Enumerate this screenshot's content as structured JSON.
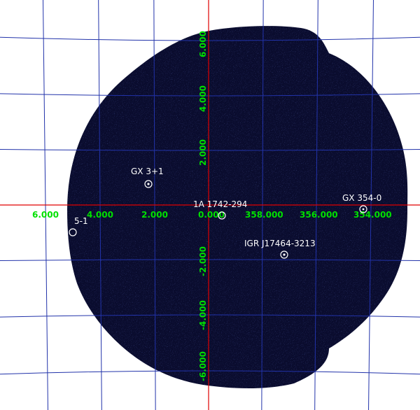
{
  "colors": {
    "background": "#ffffff",
    "sky_fill": "#0a0c2e",
    "noise": "#2a3cbf",
    "grid": "#2233aa",
    "axis": "#e00000",
    "tick_label": "#00e000",
    "source": "#ffffff"
  },
  "axes": {
    "longitude_labels": [
      "6.000",
      "4.000",
      "2.000",
      "0.000",
      "358.000",
      "356.000",
      "354.000"
    ],
    "latitude_labels": [
      "6.000",
      "4.000",
      "2.000",
      "-2.000",
      "-4.000",
      "-6.000"
    ]
  },
  "sources": [
    {
      "label": "GX 3+1"
    },
    {
      "label": "1A 1742-294"
    },
    {
      "label": "GX 354-0"
    },
    {
      "label": "IGR J17464-3213"
    },
    {
      "label": "5-1"
    }
  ]
}
